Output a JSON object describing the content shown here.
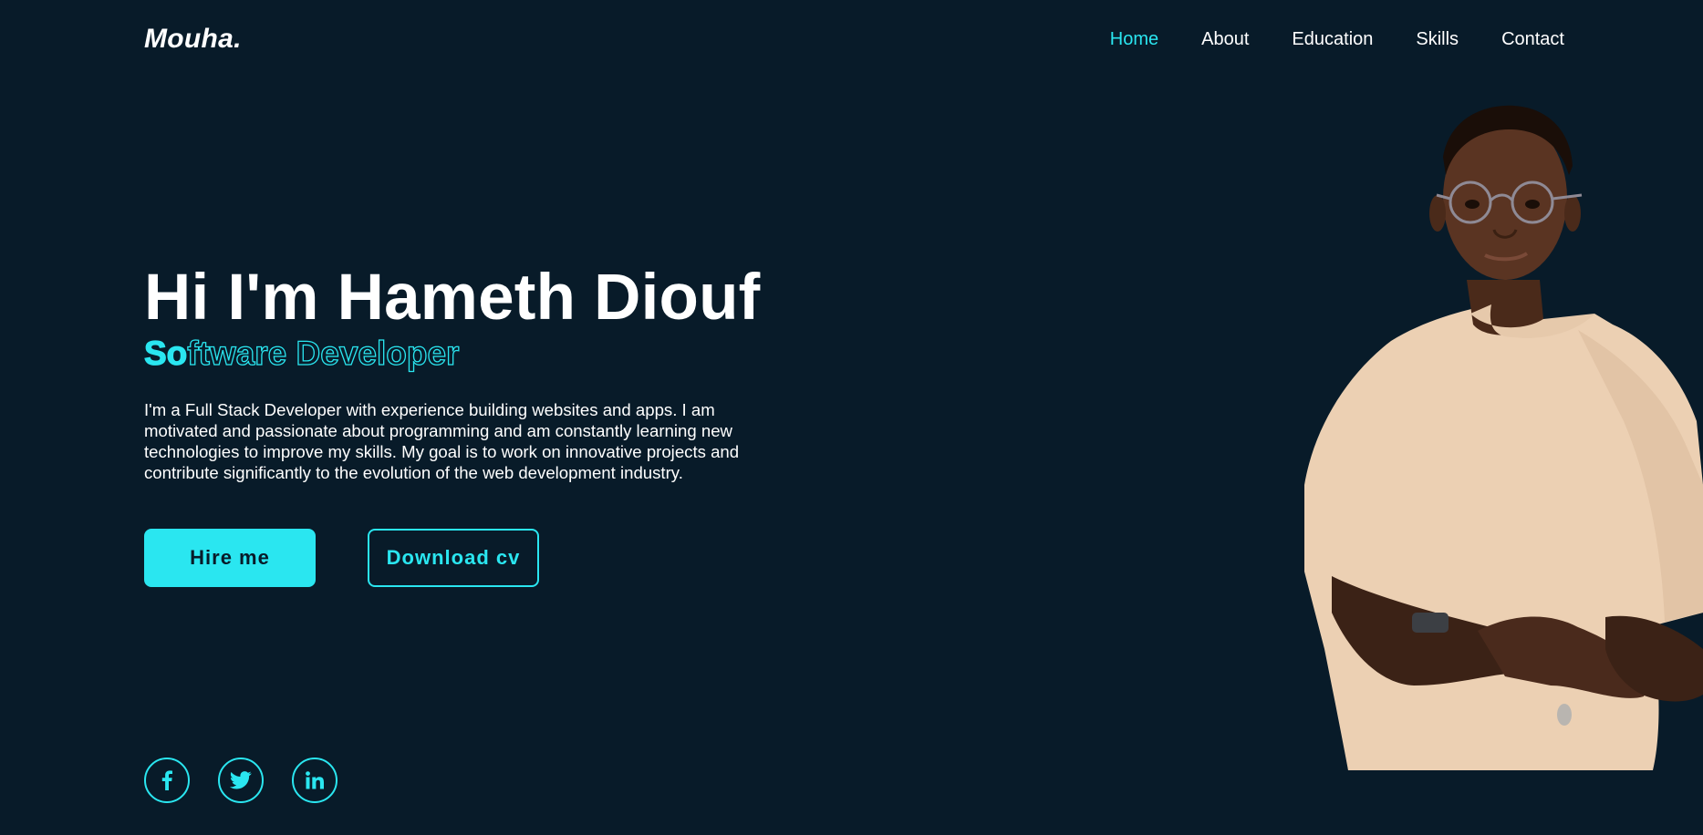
{
  "header": {
    "logo": "Mouha.",
    "nav": [
      {
        "label": "Home",
        "active": true
      },
      {
        "label": "About",
        "active": false
      },
      {
        "label": "Education",
        "active": false
      },
      {
        "label": "Skills",
        "active": false
      },
      {
        "label": "Contact",
        "active": false
      }
    ]
  },
  "hero": {
    "title": "Hi I'm Hameth Diouf",
    "role": "Software Developer",
    "role_typed": "So",
    "description": "I'm a Full Stack Developer with experience building websites and apps. I am motivated and passionate about programming and am constantly learning new technologies to improve my skills. My goal is to work on innovative projects and contribute significantly to the evolution of the web development industry.",
    "buttons": {
      "hire": "Hire me",
      "download": "Download cv"
    }
  },
  "social": [
    {
      "icon": "facebook-icon"
    },
    {
      "icon": "twitter-icon"
    },
    {
      "icon": "linkedin-icon"
    }
  ],
  "colors": {
    "background": "#081b29",
    "accent": "#2ae6f0",
    "text": "#ffffff"
  }
}
